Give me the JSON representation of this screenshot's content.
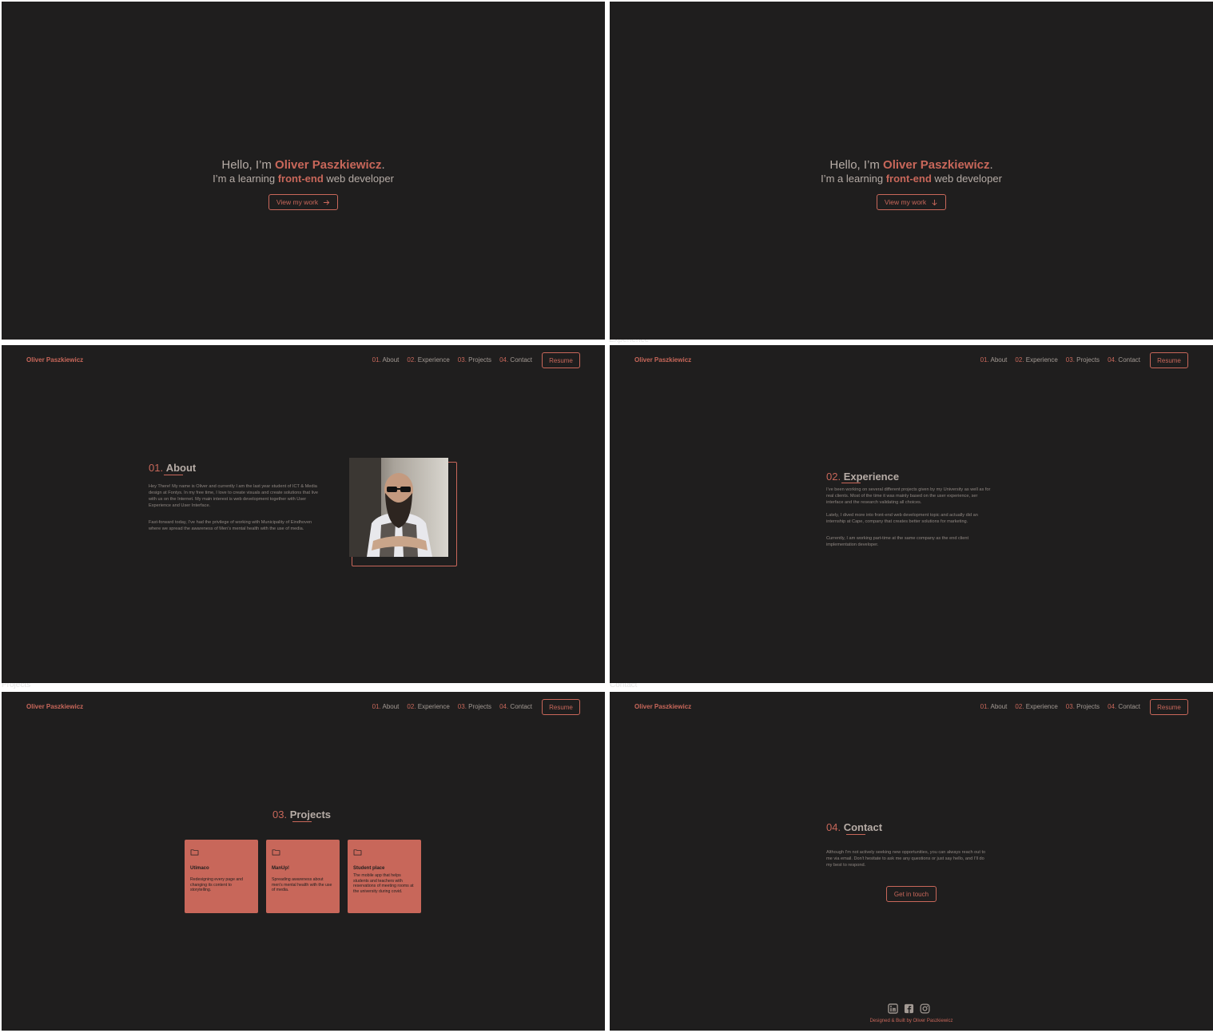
{
  "hero": {
    "greeting": "Hello, I’m ",
    "name": "Oliver Paszkiewicz",
    "period": ".",
    "tag_prefix": "I’m a learning ",
    "tag_strong": "front-end",
    "tag_suffix": " web developer",
    "button_label": "View my work"
  },
  "nav": {
    "brand": "Oliver Paszkiewicz",
    "items": [
      {
        "num": "01.",
        "label": "About"
      },
      {
        "num": "02.",
        "label": "Experience"
      },
      {
        "num": "03.",
        "label": "Projects"
      },
      {
        "num": "04.",
        "label": "Contact"
      }
    ],
    "resume": "Resume"
  },
  "gap_labels": {
    "experience": "Experience",
    "projects": "Projects",
    "contact": "Contact"
  },
  "about": {
    "num": "01.",
    "title": "About",
    "p1": "Hey There! My name is Oliver and currently I am the last year student of ICT & Media design at Fontys. In my free time, I love to create visuals and create solutions that live with us on the Internet. My main interest is web development together with User Experience and User Interface.",
    "p2": "Fast-forward today, I’ve had the privilege of working with Municipality of Eindhoven where we spread the awareness of Men’s mental health with the use of media."
  },
  "experience": {
    "num": "02.",
    "title": "Experience",
    "p1": "I’ve been working on several different projects given by my University as well as for real clients. Most of the time it was mainly based on the user experience, ser interface and the research validating all choices.",
    "p2": "Lately, I dived more into front-end web development topic and actually did an internship at Cape, company that creates better solutions for marketing.",
    "p3": "Currently, I am working part-time at the same company as the end client implementation developer."
  },
  "projects": {
    "num": "03.",
    "title": "Projects",
    "cards": [
      {
        "title": "Utimaco",
        "desc": "Redesigning every page and changing its content to storytelling."
      },
      {
        "title": "ManUp!",
        "desc": "Spreading awareness about men's mental health with the use of media."
      },
      {
        "title": "Student place",
        "desc": "The mobile app that helps students and teachers with reservations of meeting rooms at the university during covid."
      }
    ]
  },
  "contact": {
    "num": "04.",
    "title": "Contact",
    "text": "Although I'm not actively seeking new opportunities, you can always reach out to me via email. Don't hesitate to ask me any questions or just say hello, and I'll do my best to respond.",
    "button": "Get in touch",
    "socials": [
      "linkedin-icon",
      "facebook-icon",
      "instagram-icon"
    ],
    "credit": "Designed & Built by Oliver Paszkiewicz"
  },
  "colors": {
    "background": "#1f1e1e",
    "accent": "#c8675a",
    "text": "#a39a94"
  }
}
